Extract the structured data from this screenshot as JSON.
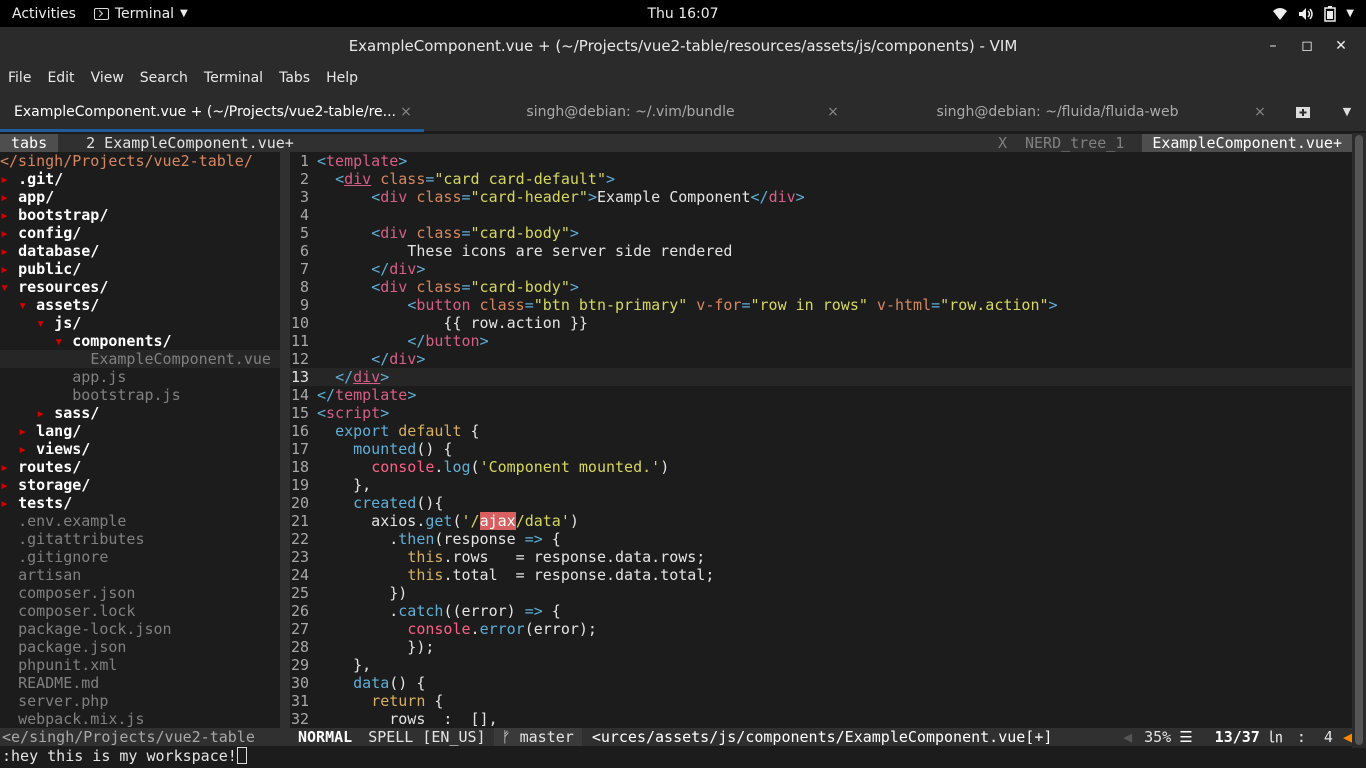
{
  "topbar": {
    "activities": "Activities",
    "app_name": "Terminal",
    "clock": "Thu 16:07"
  },
  "window": {
    "title": "ExampleComponent.vue + (~/Projects/vue2-table/resources/assets/js/components) - VIM",
    "minimize": "–",
    "maximize": "◻",
    "close": "✕"
  },
  "menu": [
    "File",
    "Edit",
    "View",
    "Search",
    "Terminal",
    "Tabs",
    "Help"
  ],
  "tabs": [
    {
      "label": "ExampleComponent.vue + (~/Projects/vue2-table/re...",
      "close": "×"
    },
    {
      "label": "singh@debian: ~/.vim/bundle",
      "close": "×"
    },
    {
      "label": "singh@debian: ~/fluida/fluida-web",
      "close": "×"
    }
  ],
  "tabline": {
    "tabs_label": "tabs",
    "buffer": "2 ExampleComponent.vue+",
    "x": "X",
    "nerd": "NERD_tree_1",
    "current": "ExampleComponent.vue+"
  },
  "nerdtree": [
    {
      "indent": "",
      "arrow": "",
      "name": "</singh/Projects/vue2-table/",
      "type": "root"
    },
    {
      "indent": "",
      "arrow": "▸ ",
      "name": ".git/",
      "type": "dir"
    },
    {
      "indent": "",
      "arrow": "▸ ",
      "name": "app/",
      "type": "dir"
    },
    {
      "indent": "",
      "arrow": "▸ ",
      "name": "bootstrap/",
      "type": "dir"
    },
    {
      "indent": "",
      "arrow": "▸ ",
      "name": "config/",
      "type": "dir"
    },
    {
      "indent": "",
      "arrow": "▸ ",
      "name": "database/",
      "type": "dir"
    },
    {
      "indent": "",
      "arrow": "▸ ",
      "name": "public/",
      "type": "dir"
    },
    {
      "indent": "",
      "arrow": "▾ ",
      "name": "resources/",
      "type": "dir"
    },
    {
      "indent": "  ",
      "arrow": "▾ ",
      "name": "assets/",
      "type": "dir"
    },
    {
      "indent": "    ",
      "arrow": "▾ ",
      "name": "js/",
      "type": "dir"
    },
    {
      "indent": "      ",
      "arrow": "▾ ",
      "name": "components/",
      "type": "dir"
    },
    {
      "indent": "          ",
      "arrow": "",
      "name": "ExampleComponent.vue",
      "type": "curfile"
    },
    {
      "indent": "        ",
      "arrow": "",
      "name": "app.js",
      "type": "file"
    },
    {
      "indent": "        ",
      "arrow": "",
      "name": "bootstrap.js",
      "type": "file"
    },
    {
      "indent": "    ",
      "arrow": "▸ ",
      "name": "sass/",
      "type": "dir"
    },
    {
      "indent": "  ",
      "arrow": "▸ ",
      "name": "lang/",
      "type": "dir"
    },
    {
      "indent": "  ",
      "arrow": "▸ ",
      "name": "views/",
      "type": "dir"
    },
    {
      "indent": "",
      "arrow": "▸ ",
      "name": "routes/",
      "type": "dir"
    },
    {
      "indent": "",
      "arrow": "▸ ",
      "name": "storage/",
      "type": "dir"
    },
    {
      "indent": "",
      "arrow": "▸ ",
      "name": "tests/",
      "type": "dir"
    },
    {
      "indent": "  ",
      "arrow": "",
      "name": ".env.example",
      "type": "file"
    },
    {
      "indent": "  ",
      "arrow": "",
      "name": ".gitattributes",
      "type": "file"
    },
    {
      "indent": "  ",
      "arrow": "",
      "name": ".gitignore",
      "type": "file"
    },
    {
      "indent": "  ",
      "arrow": "",
      "name": "artisan",
      "type": "file"
    },
    {
      "indent": "  ",
      "arrow": "",
      "name": "composer.json",
      "type": "file"
    },
    {
      "indent": "  ",
      "arrow": "",
      "name": "composer.lock",
      "type": "file"
    },
    {
      "indent": "  ",
      "arrow": "",
      "name": "package-lock.json",
      "type": "file"
    },
    {
      "indent": "  ",
      "arrow": "",
      "name": "package.json",
      "type": "file"
    },
    {
      "indent": "  ",
      "arrow": "",
      "name": "phpunit.xml",
      "type": "file"
    },
    {
      "indent": "  ",
      "arrow": "",
      "name": "README.md",
      "type": "file"
    },
    {
      "indent": "  ",
      "arrow": "",
      "name": "server.php",
      "type": "file"
    },
    {
      "indent": "  ",
      "arrow": "",
      "name": "webpack.mix.js",
      "type": "file"
    }
  ],
  "code_lines": [
    [
      [
        "tag",
        "<"
      ],
      [
        "tagname",
        "template"
      ],
      [
        "tag",
        ">"
      ]
    ],
    [
      [
        "",
        "  "
      ],
      [
        "tag",
        "<"
      ],
      [
        "tagname u",
        "div"
      ],
      [
        "",
        ""
      ],
      [
        "attr",
        " class"
      ],
      [
        "tag",
        "="
      ],
      [
        "str",
        "\"card card-default\""
      ],
      [
        "tag",
        ">"
      ]
    ],
    [
      [
        "",
        "      "
      ],
      [
        "tag",
        "<"
      ],
      [
        "tagname",
        "div"
      ],
      [
        "attr",
        " class"
      ],
      [
        "tag",
        "="
      ],
      [
        "str",
        "\"card-header\""
      ],
      [
        "tag",
        ">"
      ],
      [
        "",
        "Example Component"
      ],
      [
        "tag",
        "</"
      ],
      [
        "tagname",
        "div"
      ],
      [
        "tag",
        ">"
      ]
    ],
    [
      [
        "",
        ""
      ]
    ],
    [
      [
        "",
        "      "
      ],
      [
        "tag",
        "<"
      ],
      [
        "tagname",
        "div"
      ],
      [
        "attr",
        " class"
      ],
      [
        "tag",
        "="
      ],
      [
        "str",
        "\"card-body\""
      ],
      [
        "tag",
        ">"
      ]
    ],
    [
      [
        "",
        "          These icons are server side rendered"
      ]
    ],
    [
      [
        "",
        "      "
      ],
      [
        "tag",
        "</"
      ],
      [
        "tagname",
        "div"
      ],
      [
        "tag",
        ">"
      ]
    ],
    [
      [
        "",
        "      "
      ],
      [
        "tag",
        "<"
      ],
      [
        "tagname",
        "div"
      ],
      [
        "attr",
        " class"
      ],
      [
        "tag",
        "="
      ],
      [
        "str",
        "\"card-body\""
      ],
      [
        "tag",
        ">"
      ]
    ],
    [
      [
        "",
        "          "
      ],
      [
        "tag",
        "<"
      ],
      [
        "tagname",
        "button"
      ],
      [
        "attr",
        " class"
      ],
      [
        "tag",
        "="
      ],
      [
        "str",
        "\"btn btn-primary\""
      ],
      [
        "attr",
        " v-for"
      ],
      [
        "tag",
        "="
      ],
      [
        "str",
        "\"row in rows\""
      ],
      [
        "attr",
        " v-html"
      ],
      [
        "tag",
        "="
      ],
      [
        "str",
        "\"row.action\""
      ],
      [
        "tag",
        ">"
      ]
    ],
    [
      [
        "",
        "              {{ row.action }}"
      ]
    ],
    [
      [
        "",
        "          "
      ],
      [
        "tag",
        "</"
      ],
      [
        "tagname",
        "button"
      ],
      [
        "tag",
        ">"
      ]
    ],
    [
      [
        "",
        "      "
      ],
      [
        "tag",
        "</"
      ],
      [
        "tagname",
        "div"
      ],
      [
        "tag",
        ">"
      ]
    ],
    [
      [
        "",
        "  "
      ],
      [
        "tag",
        "</"
      ],
      [
        "tagname u",
        "div"
      ],
      [
        "tag",
        ">"
      ]
    ],
    [
      [
        "tag",
        "</"
      ],
      [
        "tagname",
        "template"
      ],
      [
        "tag",
        ">"
      ]
    ],
    [
      [
        "tag",
        "<"
      ],
      [
        "tagname",
        "script"
      ],
      [
        "tag",
        ">"
      ]
    ],
    [
      [
        "",
        "  "
      ],
      [
        "fn",
        "export"
      ],
      [
        "",
        ""
      ],
      [
        "kw",
        " default"
      ],
      [
        "",
        " {"
      ]
    ],
    [
      [
        "",
        "    "
      ],
      [
        "fn",
        "mounted"
      ],
      [
        "",
        "() {"
      ]
    ],
    [
      [
        "",
        "      "
      ],
      [
        "obj",
        "console"
      ],
      [
        "",
        "."
      ],
      [
        "fn",
        "log"
      ],
      [
        "",
        "("
      ],
      [
        "str",
        "'Component mounted.'"
      ],
      [
        "",
        ")"
      ]
    ],
    [
      [
        "",
        "    },"
      ]
    ],
    [
      [
        "",
        "    "
      ],
      [
        "fn",
        "created"
      ],
      [
        "",
        "(){"
      ]
    ],
    [
      [
        "",
        "      axios."
      ],
      [
        "fn",
        "get"
      ],
      [
        "",
        "("
      ],
      [
        "str",
        "'/"
      ],
      [
        "hl",
        "ajax"
      ],
      [
        "str",
        "/data'"
      ],
      [
        "",
        ")"
      ]
    ],
    [
      [
        "",
        "        ."
      ],
      [
        "fn",
        "then"
      ],
      [
        "",
        "(response "
      ],
      [
        "fn",
        "=>"
      ],
      [
        "",
        " {"
      ]
    ],
    [
      [
        "",
        "          "
      ],
      [
        "kw",
        "this"
      ],
      [
        "",
        ".rows   = response.data.rows;"
      ]
    ],
    [
      [
        "",
        "          "
      ],
      [
        "kw",
        "this"
      ],
      [
        "",
        ".total  = response.data.total;"
      ]
    ],
    [
      [
        "",
        "        })"
      ]
    ],
    [
      [
        "",
        "        ."
      ],
      [
        "fn",
        "catch"
      ],
      [
        "",
        "((error) "
      ],
      [
        "fn",
        "=>"
      ],
      [
        "",
        " {"
      ]
    ],
    [
      [
        "",
        "          "
      ],
      [
        "obj",
        "console"
      ],
      [
        "",
        "."
      ],
      [
        "fn",
        "error"
      ],
      [
        "",
        "(error);"
      ]
    ],
    [
      [
        "",
        "          });"
      ]
    ],
    [
      [
        "",
        "    },"
      ]
    ],
    [
      [
        "",
        "    "
      ],
      [
        "fn",
        "data"
      ],
      [
        "",
        "() {"
      ]
    ],
    [
      [
        "",
        "      "
      ],
      [
        "kw",
        "return"
      ],
      [
        "",
        " {"
      ]
    ],
    [
      [
        "",
        "        rows  :  [],"
      ]
    ]
  ],
  "current_line": 13,
  "statusline": {
    "left": "<e/singh/Projects/vue2-table",
    "mode": "NORMAL",
    "spell": "SPELL [EN_US]",
    "branch": "ᚠ master",
    "file": "<urces/assets/js/components/ExampleComponent.vue[+]",
    "percent": "35%",
    "position": "13/37",
    "ln_symbol": "㏑",
    "column": ":  4"
  },
  "cmdline": ":hey this is my workspace!",
  "colors": {
    "tab_active_underline": "#215d9c",
    "nerd_root": "#d7875f",
    "html_tag": "#5fafd7",
    "html_tagname": "#d75f87",
    "string": "#d7d75f",
    "search_highlight": "#d75f5f"
  }
}
